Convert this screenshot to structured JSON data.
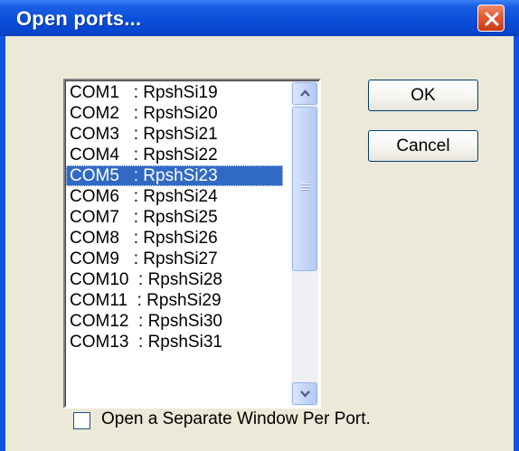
{
  "window": {
    "title": "Open ports...",
    "close_icon": "close-icon",
    "accent_color": "#0b53e0"
  },
  "port_list": {
    "selected_index": 4,
    "items": [
      "COM1   : RpshSi19",
      "COM2   : RpshSi20",
      "COM3   : RpshSi21",
      "COM4   : RpshSi22",
      "COM5   : RpshSi23",
      "COM6   : RpshSi24",
      "COM7   : RpshSi25",
      "COM8   : RpshSi26",
      "COM9   : RpshSi27",
      "COM10  : RpshSi28",
      "COM11  : RpshSi29",
      "COM12  : RpshSi30",
      "COM13  : RpshSi31"
    ]
  },
  "scrollbar": {
    "up_icon": "chevron-up-icon",
    "down_icon": "chevron-down-icon"
  },
  "buttons": {
    "ok_label": "OK",
    "cancel_label": "Cancel"
  },
  "options": {
    "separate_window_label": "Open a Separate Window Per Port.",
    "separate_window_checked": false
  }
}
